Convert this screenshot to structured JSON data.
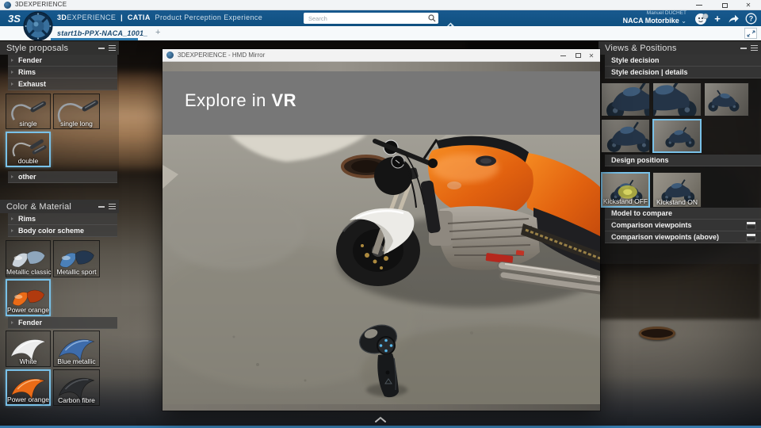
{
  "window": {
    "title": "3DEXPERIENCE"
  },
  "glyphs": {
    "close": "✕",
    "add": "+",
    "chevron_down": "⌄",
    "help": "?"
  },
  "header": {
    "brand_3d": "3D",
    "brand_rest": "EXPERIENCE",
    "separator": "|",
    "app_name": "CATIA",
    "app_suffix": "Product Perception Experience",
    "search_placeholder": "Search",
    "user_name": "Manuel DUCHET",
    "workspace": "NACA Motorbike"
  },
  "tab": {
    "name": "start1b-PPX-NACA_1001_"
  },
  "hmd": {
    "title": "3DEXPERIENCE - HMD Mirror",
    "banner_prefix": "Explore in",
    "banner_highlight": "VR"
  },
  "style_proposals": {
    "title": "Style proposals",
    "sections": [
      "Fender",
      "Rims",
      "Exhaust"
    ],
    "exhaust_options": [
      {
        "label": "single",
        "selected": false
      },
      {
        "label": "single long",
        "selected": false
      },
      {
        "label": "double",
        "selected": true
      }
    ],
    "other": "other"
  },
  "color_material": {
    "title": "Color & Material",
    "rims": "Rims",
    "body_scheme": "Body color scheme",
    "body_options": [
      {
        "label": "Metallic classic",
        "color": "#c9d2da",
        "color2": "#8ea6bc",
        "selected": false
      },
      {
        "label": "Metallic sport",
        "color": "#4b80b8",
        "color2": "#233750",
        "selected": false
      },
      {
        "label": "Power orange",
        "color": "#ea6b17",
        "color2": "#b03a0e",
        "selected": true
      }
    ],
    "fender": "Fender",
    "fender_options": [
      {
        "label": "White",
        "color": "#eceded",
        "selected": false
      },
      {
        "label": "Blue metallic",
        "color": "#3e6cab",
        "selected": false
      },
      {
        "label": "Power orange",
        "color": "#ea6b17",
        "selected": true
      },
      {
        "label": "Carbon fibre",
        "color": "#2a2c2f",
        "selected": false
      }
    ]
  },
  "views_positions": {
    "title": "Views & Positions",
    "style_decision": "Style decision",
    "style_details": "Style decision | details",
    "design_positions": "Design positions",
    "design_options": [
      {
        "label": "Kickstand OFF",
        "selected": true
      },
      {
        "label": "Kickstand ON",
        "selected": false
      }
    ],
    "model_to_compare": "Model to compare",
    "comparison_viewpoints": "Comparison viewpoints",
    "comparison_viewpoints_above": "Comparison viewpoints (above)"
  },
  "colors": {
    "header_blue": "#115387",
    "banner_blue": "#0d5b95",
    "selection_blue": "#79c1e8",
    "accent_line": "#3579ab",
    "brand_orange": "#ea6b17"
  }
}
